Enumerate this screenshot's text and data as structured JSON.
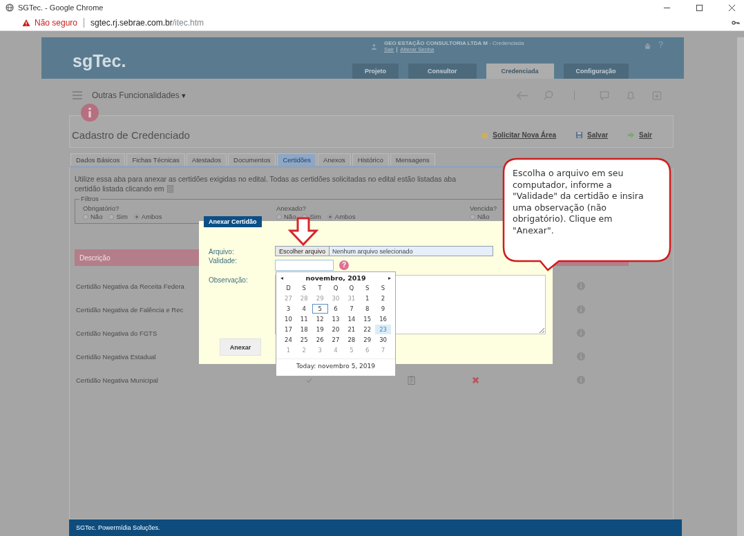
{
  "browser": {
    "title": "SGTec. - Google Chrome",
    "security": "Não seguro",
    "url_host": "sgtec.rj.sebrae.com.br",
    "url_path": "/itec.htm"
  },
  "header": {
    "logo": "sgTec.",
    "user": "**GEO ESTAÇÃO CONSULTORIA LTDA M** - Credenciada",
    "links": [
      "Sair",
      "Alterar Senha"
    ],
    "help": "?",
    "nav": [
      {
        "label": "Projeto",
        "selected": false
      },
      {
        "label": "Consultor",
        "selected": false
      },
      {
        "label": "Credenciada",
        "selected": true
      },
      {
        "label": "Configuração",
        "selected": false
      }
    ]
  },
  "toolbar": {
    "menu": "Outras Funcionalidades",
    "caret": "▾"
  },
  "page": {
    "title": "Cadastro de Credenciado",
    "actions": [
      {
        "label": "Solicitar Nova Área",
        "kind": "request"
      },
      {
        "label": "Salvar",
        "kind": "save"
      },
      {
        "label": "Sair",
        "kind": "exit"
      }
    ]
  },
  "tabs": [
    {
      "label": "Dados Básicos",
      "selected": false
    },
    {
      "label": "Fichas Técnicas",
      "selected": false
    },
    {
      "label": "Atestados",
      "selected": false
    },
    {
      "label": "Documentos",
      "selected": false
    },
    {
      "label": "Certidões",
      "selected": true
    },
    {
      "label": "Anexos",
      "selected": false
    },
    {
      "label": "Histórico",
      "selected": false
    },
    {
      "label": "Mensagens",
      "selected": false
    }
  ],
  "intro": [
    "Utilize essa aba para anexar as certidões exigidas no edital. Todas as certidões solicitadas no edital estão listadas aba",
    "certidão listada clicando em"
  ],
  "filters": {
    "legend": "Filtros",
    "groups": [
      {
        "label": "Obrigatório?",
        "options": [
          {
            "label": "Não",
            "selected": false
          },
          {
            "label": "Sim",
            "selected": false
          },
          {
            "label": "Ambos",
            "selected": true
          }
        ]
      },
      {
        "label": "Anexado?",
        "options": [
          {
            "label": "Não",
            "selected": false
          },
          {
            "label": "Sim",
            "selected": false
          },
          {
            "label": "Ambos",
            "selected": true
          }
        ]
      },
      {
        "label": "Vencida?",
        "options": [
          {
            "label": "Não",
            "selected": false
          }
        ]
      }
    ]
  },
  "table": {
    "columns": [
      "Descrição"
    ],
    "rows": [
      {
        "description": "Certidão Negativa da Receita Federa",
        "kind": "covered"
      },
      {
        "description": "Certidão Negativa de Falência e Rec",
        "kind": "covered"
      },
      {
        "description": "Certidão Negativa do FGTS",
        "kind": "covered"
      },
      {
        "description": "Certidão Negativa Estadual",
        "kind": "covered"
      },
      {
        "description": "Certidão Negativa Municipal",
        "kind": "full"
      }
    ]
  },
  "dialog": {
    "title": "Anexar Certidão",
    "file_label": "Arquivo:",
    "file_button": "Escolher arquivo",
    "file_value": "Nenhum arquivo selecionado",
    "date_label": "Validade:",
    "help": "?",
    "notes_label": "Observação:",
    "submit": "Anexar"
  },
  "calendar": {
    "prev": "◂",
    "month": "novembro, 2019",
    "next": "▸",
    "weekdays": [
      "D",
      "S",
      "T",
      "Q",
      "Q",
      "S",
      "S"
    ],
    "weeks": [
      [
        {
          "day": "27",
          "outside": true,
          "today": false,
          "selected": false
        },
        {
          "day": "28",
          "outside": true,
          "today": false,
          "selected": false
        },
        {
          "day": "29",
          "outside": true,
          "today": false,
          "selected": false
        },
        {
          "day": "30",
          "outside": true,
          "today": false,
          "selected": false
        },
        {
          "day": "31",
          "outside": true,
          "today": false,
          "selected": false
        },
        {
          "day": "1",
          "outside": false,
          "today": false,
          "selected": false
        },
        {
          "day": "2",
          "outside": false,
          "today": false,
          "selected": false
        }
      ],
      [
        {
          "day": "3",
          "outside": false,
          "today": false,
          "selected": false
        },
        {
          "day": "4",
          "outside": false,
          "today": false,
          "selected": false
        },
        {
          "day": "5",
          "outside": false,
          "today": true,
          "selected": false
        },
        {
          "day": "6",
          "outside": false,
          "today": false,
          "selected": false
        },
        {
          "day": "7",
          "outside": false,
          "today": false,
          "selected": false
        },
        {
          "day": "8",
          "outside": false,
          "today": false,
          "selected": false
        },
        {
          "day": "9",
          "outside": false,
          "today": false,
          "selected": false
        }
      ],
      [
        {
          "day": "10",
          "outside": false,
          "today": false,
          "selected": false
        },
        {
          "day": "11",
          "outside": false,
          "today": false,
          "selected": false
        },
        {
          "day": "12",
          "outside": false,
          "today": false,
          "selected": false
        },
        {
          "day": "13",
          "outside": false,
          "today": false,
          "selected": false
        },
        {
          "day": "14",
          "outside": false,
          "today": false,
          "selected": false
        },
        {
          "day": "15",
          "outside": false,
          "today": false,
          "selected": false
        },
        {
          "day": "16",
          "outside": false,
          "today": false,
          "selected": false
        }
      ],
      [
        {
          "day": "17",
          "outside": false,
          "today": false,
          "selected": false
        },
        {
          "day": "18",
          "outside": false,
          "today": false,
          "selected": false
        },
        {
          "day": "19",
          "outside": false,
          "today": false,
          "selected": false
        },
        {
          "day": "20",
          "outside": false,
          "today": false,
          "selected": false
        },
        {
          "day": "21",
          "outside": false,
          "today": false,
          "selected": false
        },
        {
          "day": "22",
          "outside": false,
          "today": false,
          "selected": false
        },
        {
          "day": "23",
          "outside": false,
          "today": false,
          "selected": true
        }
      ],
      [
        {
          "day": "24",
          "outside": false,
          "today": false,
          "selected": false
        },
        {
          "day": "25",
          "outside": false,
          "today": false,
          "selected": false
        },
        {
          "day": "26",
          "outside": false,
          "today": false,
          "selected": false
        },
        {
          "day": "27",
          "outside": false,
          "today": false,
          "selected": false
        },
        {
          "day": "28",
          "outside": false,
          "today": false,
          "selected": false
        },
        {
          "day": "29",
          "outside": false,
          "today": false,
          "selected": false
        },
        {
          "day": "30",
          "outside": false,
          "today": false,
          "selected": false
        }
      ],
      [
        {
          "day": "1",
          "outside": true,
          "today": false,
          "selected": false
        },
        {
          "day": "2",
          "outside": true,
          "today": false,
          "selected": false
        },
        {
          "day": "3",
          "outside": true,
          "today": false,
          "selected": false
        },
        {
          "day": "4",
          "outside": true,
          "today": false,
          "selected": false
        },
        {
          "day": "5",
          "outside": true,
          "today": false,
          "selected": false
        },
        {
          "day": "6",
          "outside": true,
          "today": false,
          "selected": false
        },
        {
          "day": "7",
          "outside": true,
          "today": false,
          "selected": false
        }
      ]
    ],
    "today_label": "Today: novembro 5, 2019"
  },
  "callout": "Escolha o arquivo em seu computador, informe a \"Validade\" da certidão e insira uma observação (não obrigatório). Clique em \"Anexar\".",
  "footer": "SGTec. Powermídia Soluções."
}
